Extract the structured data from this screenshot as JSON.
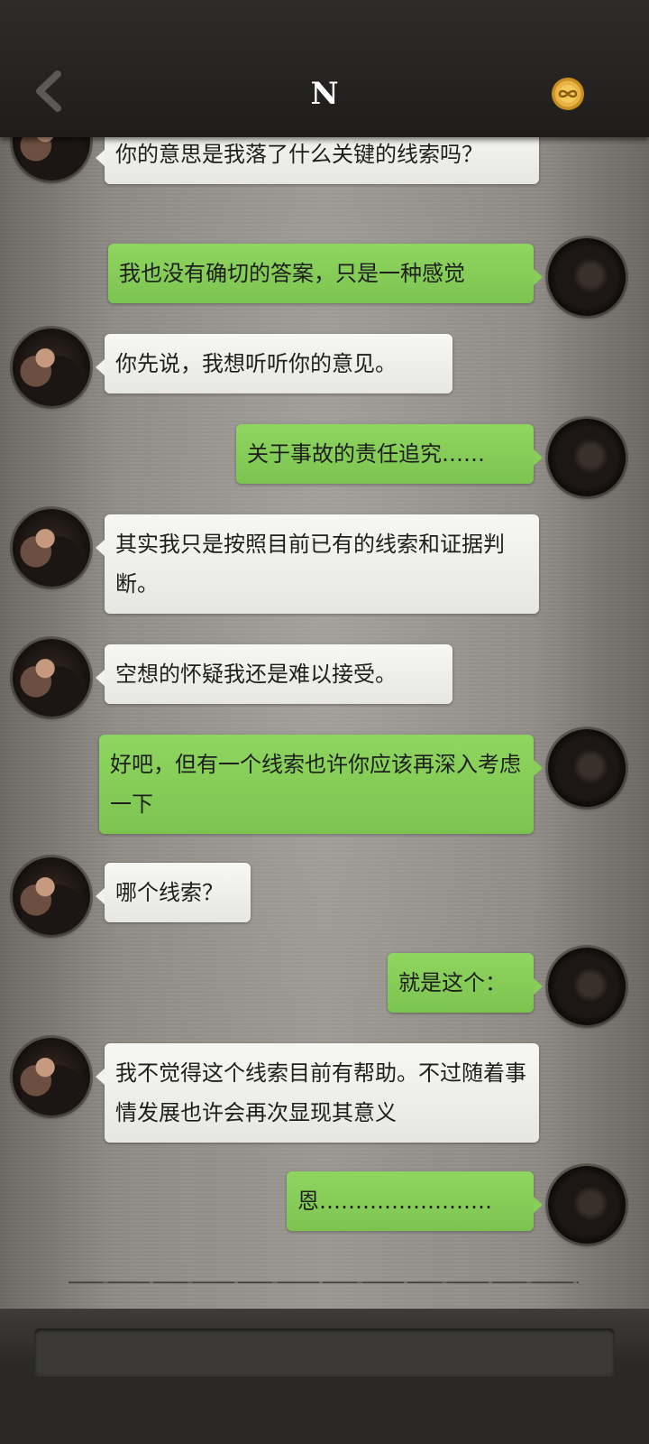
{
  "header": {
    "title": "N",
    "back_icon": "chevron-left-icon",
    "badge_icon": "infinity-medal-icon",
    "badge_color": "#d9a43a"
  },
  "messages": [
    {
      "side": "left",
      "text": "你的意思是我落了什么关键的线索吗？"
    },
    {
      "side": "right",
      "text": "我也没有确切的答案，只是一种感觉"
    },
    {
      "side": "left",
      "text": "你先说，我想听听你的意见。"
    },
    {
      "side": "right",
      "text": "关于事故的责任追究……"
    },
    {
      "side": "left",
      "text": "其实我只是按照目前已有的线索和证据判断。"
    },
    {
      "side": "left",
      "text": "空想的怀疑我还是难以接受。"
    },
    {
      "side": "right",
      "text": "好吧，但有一个线索也许你应该再深入考虑一下"
    },
    {
      "side": "left",
      "text": "哪个线索？"
    },
    {
      "side": "right",
      "text": "就是这个："
    },
    {
      "side": "left",
      "text": "我不觉得这个线索目前有帮助。不过随着事情发展也许会再次显现其意义"
    },
    {
      "side": "right",
      "text": "恩……………………"
    }
  ],
  "input": {
    "value": "",
    "placeholder": ""
  },
  "colors": {
    "sent_bubble": "#86cf59",
    "received_bubble": "#f1f1ee",
    "topbar": "#24211f"
  }
}
